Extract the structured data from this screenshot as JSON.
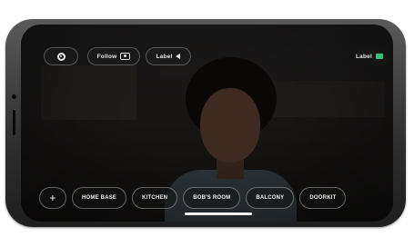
{
  "top_bar": {
    "settings_icon": "gear-icon",
    "follow_label": "Follow",
    "follow_icon": "person-frame-icon",
    "audio_label": "Label",
    "audio_icon": "speaker-icon",
    "live_label": "Label",
    "battery_icon": "battery-icon",
    "battery_color": "#36c07a"
  },
  "rooms": {
    "add_label": "+",
    "items": [
      "HOME BASE",
      "KITCHEN",
      "BOB'S ROOM",
      "BALCONY",
      "DOORKIT"
    ]
  }
}
